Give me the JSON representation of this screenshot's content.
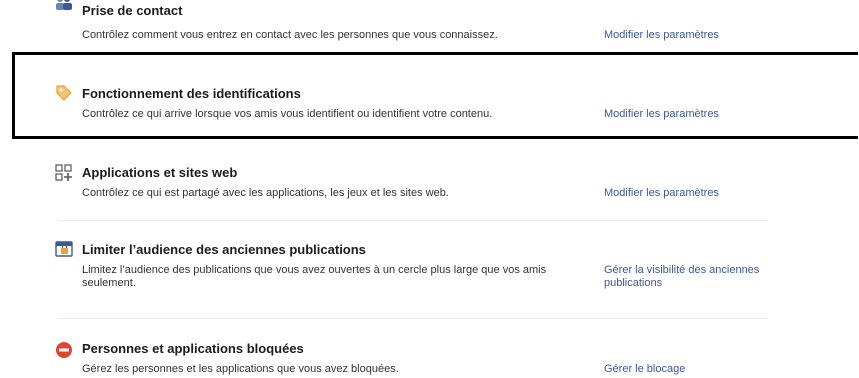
{
  "sections": [
    {
      "title": "Prise de contact",
      "description": "Contrôlez comment vous entrez en contact avec les personnes que vous connaissez.",
      "action": "Modifier les paramètres",
      "icon": "people-icon"
    },
    {
      "title": "Fonctionnement des identifications",
      "description": "Contrôlez ce qui arrive lorsque vos amis vous identifient ou identifient votre contenu.",
      "action": "Modifier les paramètres",
      "icon": "tag-icon"
    },
    {
      "title": "Applications et sites web",
      "description": "Contrôlez ce qui est partagé avec les applications, les jeux et les sites web.",
      "action": "Modifier les paramètres",
      "icon": "apps-icon"
    },
    {
      "title": "Limiter l’audience des anciennes publications",
      "description": "Limitez l’audience des publications que vous avez ouvertes à un cercle plus large que vos amis seulement.",
      "action": "Gérer la visibilité des anciennes publications",
      "icon": "lock-calendar-icon"
    },
    {
      "title": "Personnes et applications bloquées",
      "description": "Gérez les personnes et les applications que vous avez bloquées.",
      "action": "Gérer le blocage",
      "icon": "blocked-icon"
    }
  ],
  "colors": {
    "link": "#3b5998",
    "title": "#1c1c1c",
    "text": "#333333",
    "divider": "#e9e9e9",
    "highlight": "#000000",
    "blocked": "#e0452f",
    "tag": "#e8a33c"
  }
}
